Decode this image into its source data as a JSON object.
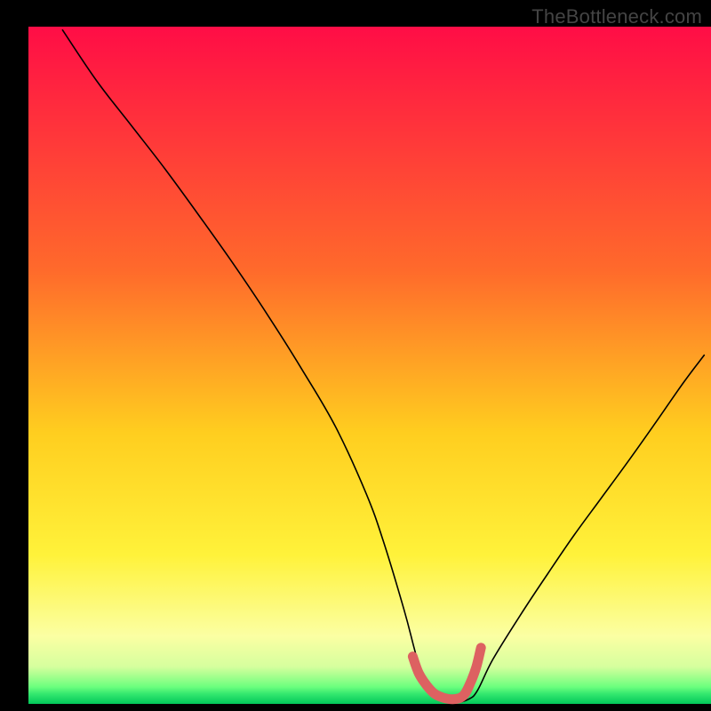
{
  "watermark": "TheBottleneck.com",
  "colors": {
    "background": "#000000",
    "curve": "#000000",
    "marker": "#dd6161"
  },
  "chart_data": {
    "type": "line",
    "title": "",
    "xlabel": "",
    "ylabel": "",
    "xlim": [
      0,
      100
    ],
    "ylim": [
      0,
      100
    ],
    "grid": false,
    "legend": false,
    "gradient_stops": [
      {
        "pct": 0,
        "color": "#ff0d46"
      },
      {
        "pct": 36,
        "color": "#ff6a2b"
      },
      {
        "pct": 60,
        "color": "#ffce1f"
      },
      {
        "pct": 78,
        "color": "#fff23a"
      },
      {
        "pct": 90,
        "color": "#fbffa3"
      },
      {
        "pct": 94.5,
        "color": "#d6ff9e"
      },
      {
        "pct": 96,
        "color": "#a2ff8d"
      },
      {
        "pct": 97.5,
        "color": "#6bff7e"
      },
      {
        "pct": 98.5,
        "color": "#35e86f"
      },
      {
        "pct": 100,
        "color": "#02c85a"
      }
    ],
    "series": [
      {
        "name": "curve",
        "x": [
          5.0,
          10.0,
          15.0,
          20.0,
          25.0,
          30.0,
          35.0,
          40.0,
          45.0,
          49.5,
          52.0,
          55.0,
          56.5,
          58.0,
          60.0,
          62.5,
          64.5,
          65.8,
          68.0,
          72.0,
          76.0,
          80.0,
          84.0,
          88.0,
          92.0,
          96.0,
          99.0
        ],
        "values": [
          99.5,
          92.0,
          85.5,
          79.0,
          72.1,
          65.0,
          57.5,
          49.5,
          40.9,
          31.0,
          24.0,
          14.0,
          8.3,
          2.8,
          0.7,
          0.2,
          0.7,
          2.0,
          6.5,
          13.0,
          19.1,
          25.0,
          30.5,
          36.0,
          41.7,
          47.5,
          51.5
        ]
      },
      {
        "name": "marker",
        "x": [
          56.3,
          57.2,
          58.3,
          59.5,
          60.8,
          62.3,
          63.7,
          64.7,
          65.6,
          66.3
        ],
        "values": [
          7.0,
          4.5,
          2.8,
          1.5,
          0.9,
          0.7,
          1.2,
          3.0,
          5.4,
          8.3
        ]
      }
    ],
    "notes": "Values are read approximately from pixel positions; the chart has no numeric tick labels so values are fractions of the plot area (0–100 in each axis, y measured as height above the bottom of the gradient)."
  }
}
